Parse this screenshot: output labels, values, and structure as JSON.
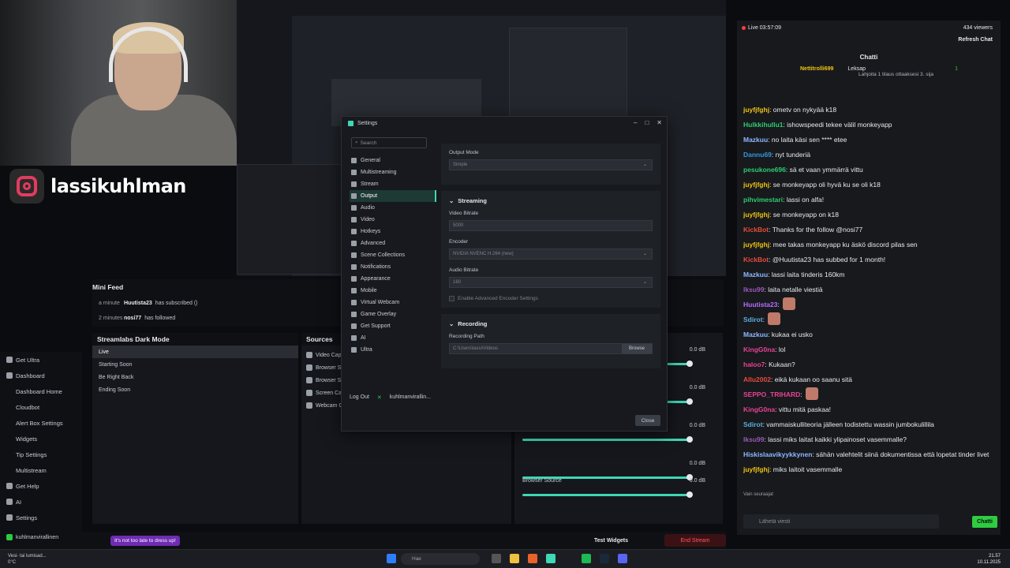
{
  "overlay": {
    "instagram_handle": "lassikuhlman"
  },
  "leftnav": {
    "items": [
      {
        "label": "Get Ultra",
        "sub": false
      },
      {
        "label": "Dashboard",
        "sub": false
      },
      {
        "label": "Dashboard Home",
        "sub": true
      },
      {
        "label": "Cloudbot",
        "sub": true
      },
      {
        "label": "Alert Box Settings",
        "sub": true
      },
      {
        "label": "Widgets",
        "sub": true
      },
      {
        "label": "Tip Settings",
        "sub": true
      },
      {
        "label": "Multistream",
        "sub": true
      },
      {
        "label": "Get Help",
        "sub": false
      },
      {
        "label": "AI",
        "sub": false
      },
      {
        "label": "Settings",
        "sub": false
      }
    ],
    "account": "kuhlmanvirallinen"
  },
  "minifeed": {
    "title": "Mini Feed",
    "rows": [
      {
        "time": "a minute",
        "user": "Huutista23",
        "action": "has subscribed ()"
      },
      {
        "time": "2 minutes",
        "user": "nosi77",
        "action": "has followed"
      }
    ]
  },
  "scenes": {
    "title": "Streamlabs Dark Mode",
    "items": [
      "Live",
      "Starting Soon",
      "Be Right Back",
      "Ending Soon"
    ]
  },
  "sources": {
    "title": "Sources",
    "items": [
      "Video Cap",
      "Browser S",
      "Browser S",
      "Screen Ca",
      "Webcam C"
    ]
  },
  "mixer": {
    "rows": [
      {
        "label": "",
        "db": "0.0 dB"
      },
      {
        "label": "",
        "db": "0.0 dB"
      },
      {
        "label": "",
        "db": "0.0 dB"
      },
      {
        "label": "",
        "db": "0.0 dB"
      },
      {
        "label": "Browser Source",
        "db": "0.0 dB"
      }
    ]
  },
  "bottombar": {
    "promo": "It's not too late to dress up!",
    "test_widgets": "Test Widgets",
    "end_stream": "End Stream"
  },
  "settings": {
    "title": "Settings",
    "search_placeholder": "Search",
    "menu": [
      "General",
      "Multistreaming",
      "Stream",
      "Output",
      "Audio",
      "Video",
      "Hotkeys",
      "Advanced",
      "Scene Collections",
      "Notifications",
      "Appearance",
      "Mobile",
      "Virtual Webcam",
      "Game Overlay",
      "Get Support",
      "AI",
      "Ultra"
    ],
    "active_index": 3,
    "logout": "Log Out",
    "account": "kuhlmanvirallin...",
    "output_mode_label": "Output Mode",
    "output_mode_value": "Simple",
    "streaming_header": "Streaming",
    "video_bitrate_label": "Video Bitrate",
    "video_bitrate_value": "5000",
    "encoder_label": "Encoder",
    "encoder_value": "NVIDIA NVENC H.264 (new)",
    "audio_bitrate_label": "Audio Bitrate",
    "audio_bitrate_value": "160",
    "advanced_encoder_label": "Enable Advanced Encoder Settings",
    "recording_header": "Recording",
    "recording_path_label": "Recording Path",
    "recording_path_value": "C:\\Users\\lassi\\Videos",
    "browse": "Browse",
    "close": "Close"
  },
  "chat": {
    "live_time": "Live 03:57:09",
    "viewers": "434 viewers",
    "refresh": "Refresh Chat",
    "title": "Chatti",
    "pinned_user": "Nettitrolli699",
    "pinned_count": "1",
    "pinned_leksap": "Leksap",
    "pinned_text": "Lahjoita 1 tilaus ottaaksesi 3. sija",
    "messages": [
      {
        "user": "juyfjfghj",
        "color": "#f1c40f",
        "text": "ometv on nykyää k18"
      },
      {
        "user": "Hulkkihullu1",
        "color": "#2ecc71",
        "text": "ishowspeedi tekee välil monkeyapp"
      },
      {
        "user": "Mazkuu",
        "color": "#8fb8ff",
        "text": "no laita käsi sen **** etee"
      },
      {
        "user": "Dannu69",
        "color": "#3498db",
        "text": "nyt tunderiä"
      },
      {
        "user": "pesukone696",
        "color": "#2ecc71",
        "text": "sä et vaan ymmärrä vittu"
      },
      {
        "user": "juyfjfghj",
        "color": "#f1c40f",
        "text": "se monkeyapp oli hyvä ku se oli k18"
      },
      {
        "user": "pihvimestari",
        "color": "#2ecc71",
        "text": "lassi on alfa!"
      },
      {
        "user": "juyfjfghj",
        "color": "#f1c40f",
        "text": "se monkeyapp on k18"
      },
      {
        "user": "KickBot",
        "color": "#e74c3c",
        "text": "Thanks for the follow @nosi77"
      },
      {
        "user": "juyfjfghj",
        "color": "#f1c40f",
        "text": "mee takas monkeyapp ku äskö discord pilas sen"
      },
      {
        "user": "KickBot",
        "color": "#e74c3c",
        "text": "@Huutista23 has subbed for 1 month!"
      },
      {
        "user": "Mazkuu",
        "color": "#8fb8ff",
        "text": "lassi laita tinderis 160km"
      },
      {
        "user": "Iksu99",
        "color": "#9b59b6",
        "text": "laita netalle viestiä"
      },
      {
        "user": "Huutista23",
        "color": "#b86bff",
        "text": ""
      },
      {
        "user": "Sdirot",
        "color": "#5dade2",
        "text": ""
      },
      {
        "user": "Mazkuu",
        "color": "#8fb8ff",
        "text": "kukaa ei usko"
      },
      {
        "user": "KingG0na",
        "color": "#e84393",
        "text": "lol"
      },
      {
        "user": "haloo7",
        "color": "#e84393",
        "text": "Kukaan?"
      },
      {
        "user": "Allu2002",
        "color": "#e74c3c",
        "text": "eikä kukaan oo saanu sitä"
      },
      {
        "user": "SEPPO_TRIHARD",
        "color": "#e84393",
        "text": ""
      },
      {
        "user": "KingG0na",
        "color": "#e84393",
        "text": "vittu mitä paskaa!"
      },
      {
        "user": "Sdirot",
        "color": "#5dade2",
        "text": "vammaiskulliteoria jälleen todistettu wassin jumbokulillila"
      },
      {
        "user": "Iksu99",
        "color": "#9b59b6",
        "text": "lassi miks laitat kaikki ylipainoset vasemmalle?"
      },
      {
        "user": "Hiskislaavikyykkynen",
        "color": "#8fb8ff",
        "text": "sähän valehtelit siinä dokumentissa että lopetat tinder livet"
      },
      {
        "user": "juyfjfghj",
        "color": "#f1c40f",
        "text": "miks laitoit vasemmalle"
      }
    ],
    "followers_label": "Vain seuraajat",
    "input_placeholder": "Lähetä viesti",
    "send": "Chatti"
  },
  "taskbar": {
    "weather_title": "Vesi- tai lumisad...",
    "weather_temp": "0°C",
    "search": "Hae",
    "time": "21.57",
    "date": "10.11.2025"
  }
}
